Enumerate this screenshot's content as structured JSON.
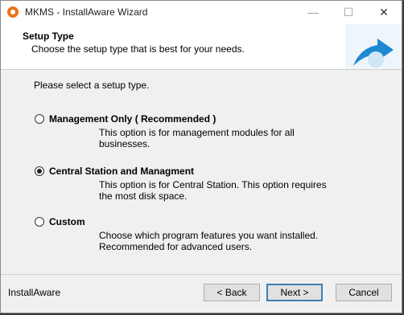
{
  "window": {
    "title": "MKMS - InstallAware Wizard",
    "controls": {
      "minimize": "—",
      "maximize": "☐",
      "close": "✕"
    }
  },
  "header": {
    "title": "Setup Type",
    "subtitle": "Choose the setup type that is best for your needs."
  },
  "main": {
    "prompt": "Please select a setup type.",
    "options": [
      {
        "label": "Management Only ( Recommended )",
        "description": "This option is for management modules for all businesses.",
        "selected": false
      },
      {
        "label": "Central Station and Managment",
        "description": "This option is for Central Station. This option requires the most disk space.",
        "selected": true
      },
      {
        "label": "Custom",
        "description": "Choose which program features you want installed. Recommended for advanced users.",
        "selected": false
      }
    ]
  },
  "footer": {
    "brand": "InstallAware",
    "back_label": "< Back",
    "next_label": "Next >",
    "cancel_label": "Cancel"
  },
  "colors": {
    "accent": "#3c7fb1",
    "header_art": "#1e88d2",
    "icon": "#e8741c"
  }
}
